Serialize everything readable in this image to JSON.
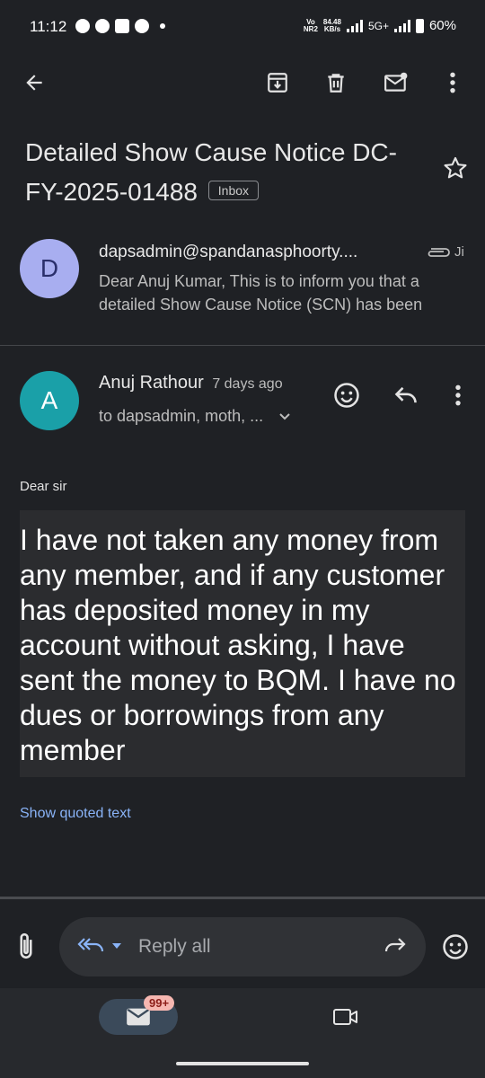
{
  "status_bar": {
    "time": "11:12",
    "net_speed_value": "84.48",
    "net_speed_unit": "KB/s",
    "volte": "Vo",
    "nr": "NR2",
    "network": "5G+",
    "battery": "60%"
  },
  "icons": {
    "back": "arrow-left-icon",
    "archive": "archive-icon",
    "delete": "trash-icon",
    "mark_unread": "mark-unread-icon",
    "more": "more-vert-icon",
    "star": "star-icon",
    "attachment": "paperclip-icon",
    "emoji": "emoji-icon",
    "reply": "reply-icon",
    "reply_all": "reply-all-icon",
    "forward": "forward-icon",
    "mail": "mail-icon",
    "video": "video-icon"
  },
  "subject": {
    "title": "Detailed Show Cause Notice DC-FY-2025-01488",
    "label_chip": "Inbox"
  },
  "collapsed_message": {
    "avatar_letter": "D",
    "sender": "dapsadmin@spandanasphoorty....",
    "date_fragment": "Ji",
    "snippet": "Dear Anuj Kumar, This is to inform you that a detailed Show Cause Notice (SCN) has been"
  },
  "open_message": {
    "avatar_letter": "A",
    "sender": "Anuj Rathour",
    "time": "7 days ago",
    "recipients": "to dapsadmin, moth, ...",
    "greeting": "Dear sir",
    "body": "I have not taken any money from any member, and if any customer has deposited money in my account without asking, I have sent the money to BQM. I have no dues or borrowings from any member",
    "show_quoted": "Show quoted text"
  },
  "reply_bar": {
    "placeholder": "Reply all"
  },
  "bottom_nav": {
    "mail_badge": "99+"
  },
  "colors": {
    "background": "#1f2125",
    "avatar_d": "#a8aef0",
    "avatar_a": "#1aa0a8",
    "link": "#8ab4f8"
  }
}
